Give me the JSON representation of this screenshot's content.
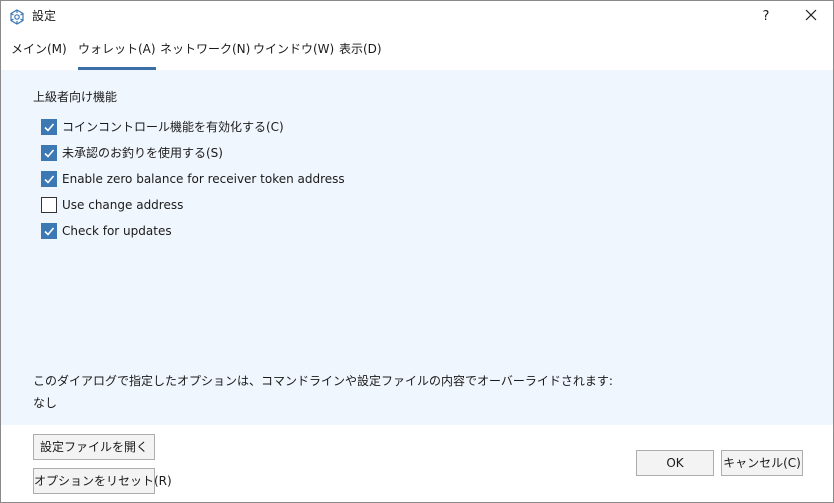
{
  "window": {
    "title": "設定",
    "help_label": "?"
  },
  "tabs": [
    {
      "label": "メイン(M)",
      "active": false
    },
    {
      "label": "ウォレット(A)",
      "active": true
    },
    {
      "label": "ネットワーク(N)",
      "active": false
    },
    {
      "label": "ウインドウ(W)",
      "active": false
    },
    {
      "label": "表示(D)",
      "active": false
    }
  ],
  "section": {
    "title": "上級者向け機能"
  },
  "options": [
    {
      "label": "コインコントロール機能を有効化する(C)",
      "checked": true
    },
    {
      "label": "未承認のお釣りを使用する(S)",
      "checked": true
    },
    {
      "label": "Enable zero balance for receiver token address",
      "checked": true
    },
    {
      "label": "Use change address",
      "checked": false
    },
    {
      "label": "Check for updates",
      "checked": true
    }
  ],
  "override_note": {
    "text": "このダイアログで指定したオプションは、コマンドラインや設定ファイルの内容でオーバーライドされます:",
    "value": "なし"
  },
  "buttons": {
    "open_config": "設定ファイルを開く",
    "reset_options": "オプションをリセット(R)",
    "ok": "OK",
    "cancel": "キャンセル(C)"
  },
  "colors": {
    "accent": "#3c78b4",
    "content_bg": "#f0f6fd",
    "tab_underline": "#3a6ea5"
  }
}
